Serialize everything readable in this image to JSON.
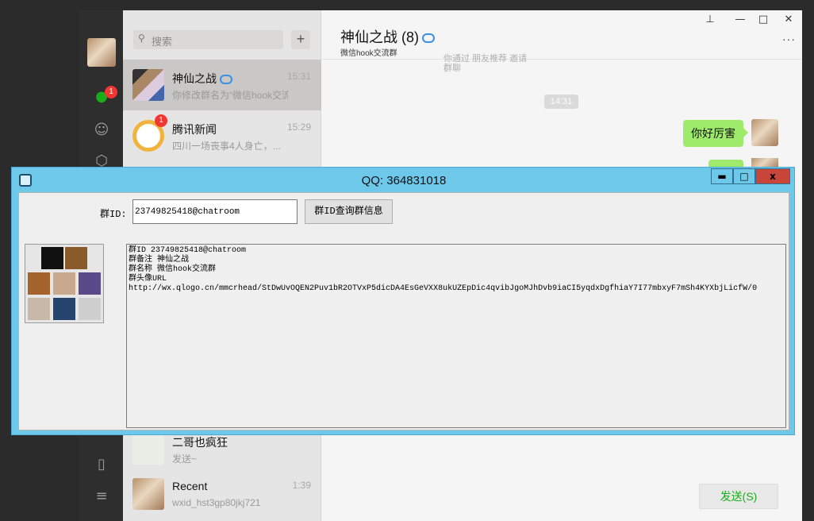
{
  "wechat": {
    "search_placeholder": "搜索",
    "add_label": "+",
    "rail": {
      "chat_badge": "1"
    },
    "chats": [
      {
        "name": "神仙之战",
        "preview": "你修改群名为“微信hook交流群”",
        "time": "15:31",
        "badge": ""
      },
      {
        "name": "腾讯新闻",
        "preview": "四川一场丧事4人身亡，...",
        "time": "15:29",
        "badge": "1"
      },
      {
        "name": "二哥也疯狂",
        "preview": "发送~",
        "time": "",
        "badge": ""
      },
      {
        "name": "Recent",
        "preview": "wxid_hst3gp80jkj721",
        "time": "1:39",
        "badge": ""
      }
    ],
    "conversation": {
      "title": "神仙之战 (8)",
      "subtitle": "微信hook交流群",
      "system_text": "你通过 朋友推荐 邀请他们加入群聊，",
      "system_text2": "群聊",
      "time_tag": "14:31",
      "message": "你好厉害",
      "send_label": "发送(S)",
      "more_label": "···"
    }
  },
  "dialog": {
    "title": "QQ: 364831018",
    "min_label": "▬",
    "max_label": "□",
    "close_label": "x",
    "group_id_label": "群ID:",
    "group_id_value": "23749825418@chatroom",
    "query_button": "群ID查询群信息",
    "output_lines": [
      "群ID 23749825418@chatroom",
      "群备注 神仙之战",
      "群名称 微信hook交流群",
      "群头像URL",
      "http://wx.qlogo.cn/mmcrhead/StDwUvOQEN2Puv1bR2OTVxP5dicDA4EsGeVXX8ukUZEpDic4qvibJgoMJhDvb9iaCI5yqdxDgfhiaY7I77mbxyF7mSh4KYXbjLicfW/0"
    ]
  },
  "colors": {
    "wechat_green": "#1aad19",
    "bubble_green": "#9eea6a",
    "dialog_titlebar": "#6dc8ea",
    "close_red": "#c8453a",
    "badge_red": "#f43530"
  }
}
